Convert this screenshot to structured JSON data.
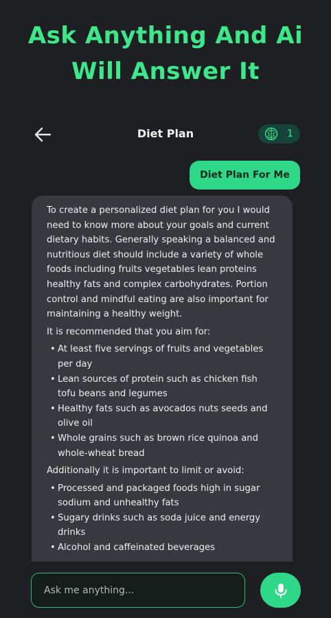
{
  "headline": {
    "line1": "Ask Anything And Ai",
    "line2": "Will Answer It"
  },
  "topbar": {
    "title": "Diet Plan",
    "credits": "1"
  },
  "chat": {
    "user_message": "Diet Plan For Me",
    "ai_intro": "To create a personalized diet plan for you I would need to know more about your goals and current dietary habits. Generally speaking a balanced and nutritious diet should include a variety of whole foods including fruits vegetables lean proteins healthy fats and complex carbohydrates. Portion control and mindful eating are also important for maintaining a healthy weight.",
    "ai_recommend_heading": "It is recommended that you aim for:",
    "ai_recommend_items": [
      "At least five servings of fruits and vegetables per day",
      "Lean sources of protein such as chicken fish tofu beans and legumes",
      "Healthy fats such as avocados nuts seeds and olive oil",
      "Whole grains such as brown rice quinoa and whole-wheat bread"
    ],
    "ai_avoid_heading": "Additionally it is important to limit or avoid:",
    "ai_avoid_items": [
      "Processed and packaged foods high in sugar sodium and unhealthy fats",
      "Sugary drinks such as soda juice and energy drinks",
      "Alcohol and caffeinated beverages"
    ]
  },
  "input": {
    "placeholder": "Ask me anything..."
  },
  "colors": {
    "accent": "#2fd889",
    "headline": "#3ee88a",
    "background": "#1e1f22",
    "bubble": "#38393e"
  },
  "icons": {
    "back": "arrow-left-icon",
    "credits": "brain-icon",
    "mic": "microphone-icon"
  }
}
